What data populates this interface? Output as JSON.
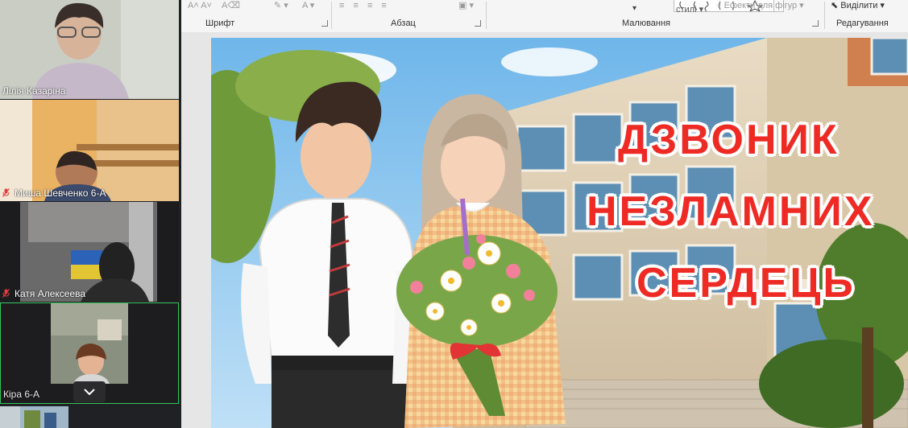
{
  "ribbon": {
    "groups": {
      "font": "Шрифт",
      "paragraph": "Абзац",
      "drawing": "Малювання",
      "editing": "Редагування"
    },
    "buttons": {
      "styles": "стилі",
      "shape_effects": "Ефекти для фігур",
      "select": "Виділити"
    }
  },
  "participants": [
    {
      "name": "Лілія Казаріна",
      "muted": false
    },
    {
      "name": "Миша Шевченко 6-А",
      "muted": true
    },
    {
      "name": "Катя Алексеева",
      "muted": true
    },
    {
      "name": "Кіра 6-А",
      "muted": false
    }
  ],
  "slide": {
    "title_lines": [
      "ДЗВОНИК",
      "НЕЗЛАМНИХ",
      "СЕРДЕЦЬ"
    ]
  },
  "colors": {
    "title_red": "#ee2a25",
    "active_speaker": "#33c35a"
  },
  "icons": {
    "mic": "mic-off-icon",
    "collapse": "chevron-down-icon",
    "select": "cursor-arrow-icon"
  }
}
